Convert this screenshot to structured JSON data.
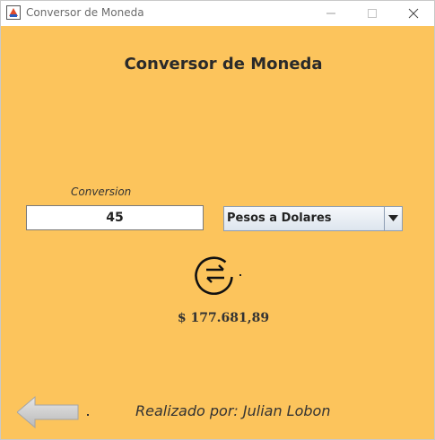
{
  "window": {
    "title": "Conversor de Moneda"
  },
  "main": {
    "heading": "Conversor de Moneda",
    "conversion_label": "Conversion",
    "amount_value": "45",
    "conversion_type": "Pesos a Dolares",
    "result": "$ 177.681,89",
    "credit": "Realizado por: Julian Lobon"
  },
  "icons": {
    "app": "java-icon",
    "swap": "swap-arrows-icon",
    "back": "back-arrow-icon"
  },
  "colors": {
    "background": "#fcc45c",
    "titlebar": "#ffffff"
  }
}
